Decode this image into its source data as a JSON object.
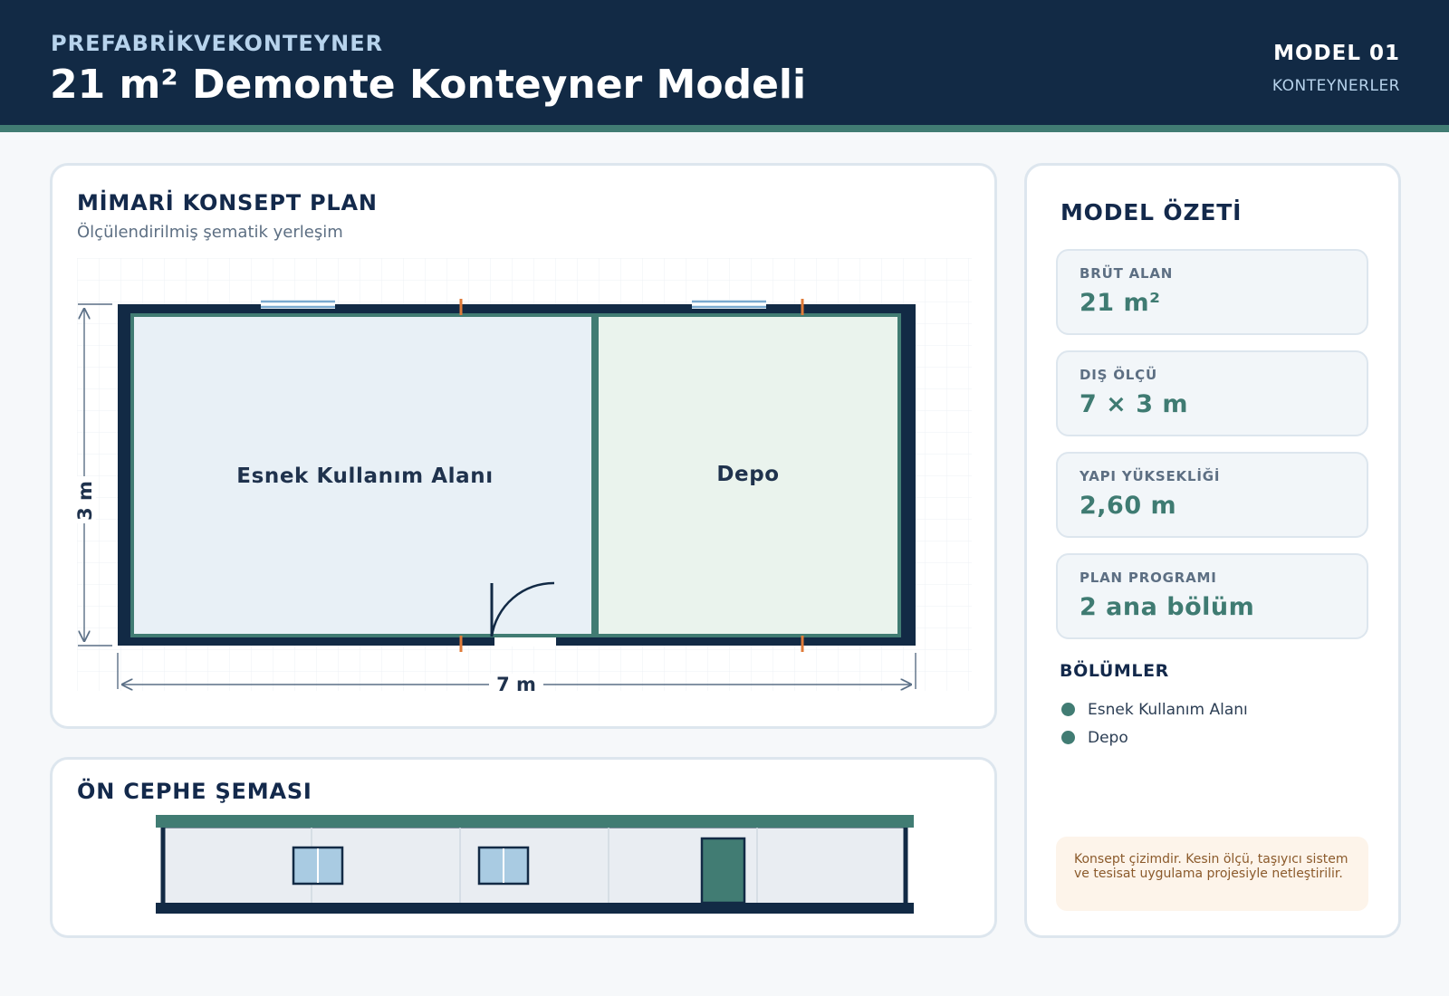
{
  "header": {
    "brand": "PREFABRİKVEKONTEYNER",
    "title": "21 m² Demonte Konteyner Modeli",
    "model_label": "MODEL 01",
    "category": "KONTEYNERLER"
  },
  "plan": {
    "title": "MİMARİ KONSEPT PLAN",
    "subtitle": "Ölçülendirilmiş şematik yerleşim",
    "rooms": [
      "Esnek Kullanım Alanı",
      "Depo"
    ],
    "width_label": "7 m",
    "height_label": "3 m"
  },
  "facade": {
    "title": "ÖN CEPHE ŞEMASI"
  },
  "summary": {
    "title": "MODEL ÖZETİ",
    "stats": [
      {
        "label": "BRÜT ALAN",
        "value": "21 m²"
      },
      {
        "label": "DIŞ ÖLÇÜ",
        "value": "7 × 3 m"
      },
      {
        "label": "YAPI YÜKSEKLİĞİ",
        "value": "2,60 m"
      },
      {
        "label": "PLAN PROGRAMI",
        "value": "2 ana bölüm"
      }
    ],
    "sections_heading": "BÖLÜMLER",
    "sections": [
      "Esnek Kullanım Alanı",
      "Depo"
    ],
    "note": "Konsept çizimdir. Kesin ölçü, taşıyıcı sistem ve tesisat uygulama projesiyle netleştirilir."
  },
  "colors": {
    "navy": "#122a45",
    "teal": "#417c73",
    "room_1_fill": "#e8f0f6",
    "room_2_fill": "#eaf3ed",
    "window_glass": "#a9cbe2",
    "column_orange": "#e07b39"
  }
}
